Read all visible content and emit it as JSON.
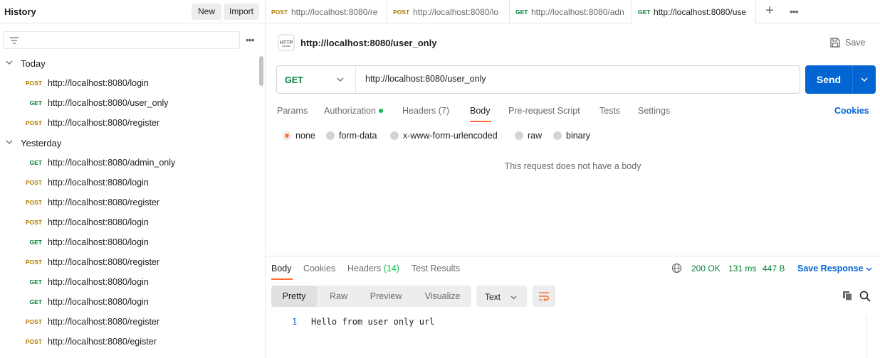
{
  "sidebar": {
    "title": "History",
    "new_label": "New",
    "import_label": "Import",
    "more_label": "•••",
    "groups": [
      {
        "label": "Today",
        "items": [
          {
            "method": "POST",
            "url": "http://localhost:8080/login"
          },
          {
            "method": "GET",
            "url": "http://localhost:8080/user_only"
          },
          {
            "method": "POST",
            "url": "http://localhost:8080/register"
          }
        ]
      },
      {
        "label": "Yesterday",
        "items": [
          {
            "method": "GET",
            "url": "http://localhost:8080/admin_only"
          },
          {
            "method": "POST",
            "url": "http://localhost:8080/login"
          },
          {
            "method": "POST",
            "url": "http://localhost:8080/register"
          },
          {
            "method": "POST",
            "url": "http://localhost:8080/login"
          },
          {
            "method": "GET",
            "url": "http://localhost:8080/login"
          },
          {
            "method": "POST",
            "url": "http://localhost:8080/register"
          },
          {
            "method": "GET",
            "url": "http://localhost:8080/login"
          },
          {
            "method": "GET",
            "url": "http://localhost:8080/login"
          },
          {
            "method": "POST",
            "url": "http://localhost:8080/register"
          },
          {
            "method": "POST",
            "url": "http://localhost:8080/egister"
          }
        ]
      }
    ]
  },
  "tabs": [
    {
      "method": "POST",
      "url": "http://localhost:8080/re"
    },
    {
      "method": "POST",
      "url": "http://localhost:8080/lo"
    },
    {
      "method": "GET",
      "url": "http://localhost:8080/adn"
    },
    {
      "method": "GET",
      "url": "http://localhost:8080/use"
    }
  ],
  "tab_more_label": "•••",
  "request": {
    "title": "http://localhost:8080/user_only",
    "save_label": "Save",
    "method": "GET",
    "url": "http://localhost:8080/user_only",
    "send_label": "Send",
    "subtabs": {
      "params": "Params",
      "authorization": "Authorization",
      "headers": "Headers (7)",
      "body": "Body",
      "prerequest": "Pre-request Script",
      "tests": "Tests",
      "settings": "Settings"
    },
    "cookies_label": "Cookies",
    "body_types": [
      "none",
      "form-data",
      "x-www-form-urlencoded",
      "raw",
      "binary"
    ],
    "selected_body_type": "none",
    "empty_body_text": "This request does not have a body"
  },
  "response": {
    "tabs": {
      "body": "Body",
      "cookies": "Cookies",
      "headers": "Headers",
      "headers_count": "(14)",
      "test_results": "Test Results"
    },
    "status": "200 OK",
    "time": "131 ms",
    "size": "447 B",
    "save_response_label": "Save Response",
    "views": [
      "Pretty",
      "Raw",
      "Preview",
      "Visualize"
    ],
    "active_view": "Pretty",
    "format": "Text",
    "lines": [
      {
        "no": "1",
        "text": "Hello from user only url"
      }
    ]
  },
  "colors": {
    "post": "#ad7a03",
    "get": "#007f31",
    "accent": "#ff6c37",
    "primary": "#0265d2"
  }
}
